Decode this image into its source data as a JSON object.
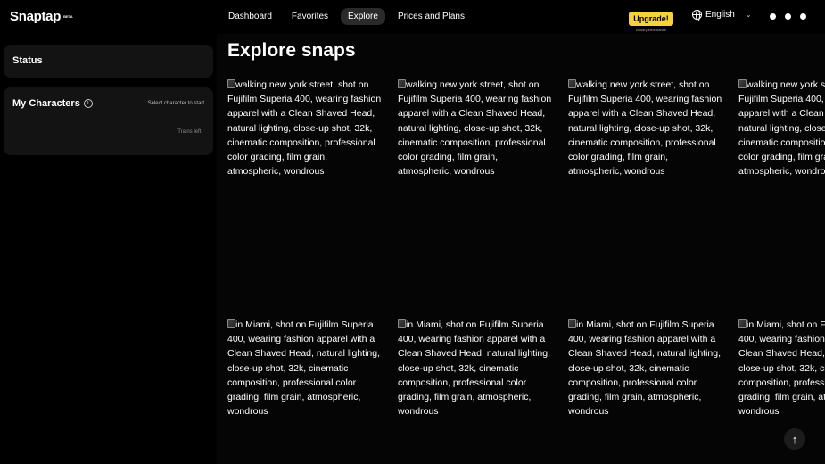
{
  "app": {
    "logo": "Snaptap",
    "beta": "BETA"
  },
  "nav": [
    {
      "label": "Dashboard",
      "active": false
    },
    {
      "label": "Favorites",
      "active": false
    },
    {
      "label": "Explore",
      "active": true
    },
    {
      "label": "Prices and Plans",
      "active": false
    }
  ],
  "upgrade": {
    "label": "Upgrade!",
    "subtitle": "Boost performance",
    "color": "#f6d23c"
  },
  "language": {
    "label": "English"
  },
  "sidebar": {
    "status_title": "Status",
    "characters_title": "My Characters",
    "select_hint": "Select character to start",
    "trains_left": "Trains left:"
  },
  "main": {
    "title": "Explore snaps",
    "row1_alt": "walking new york street, shot on Fujifilm Superia 400, wearing fashion apparel with a Clean Shaved Head, natural lighting, close-up shot, 32k, cinematic composition, professional color grading, film grain, atmospheric, wondrous",
    "row2_alt": "in Miami, shot on Fujifilm Superia 400, wearing fashion apparel with a Clean Shaved Head, natural lighting, close-up shot, 32k, cinematic composition, professional color grading, film grain, atmospheric, wondrous"
  }
}
